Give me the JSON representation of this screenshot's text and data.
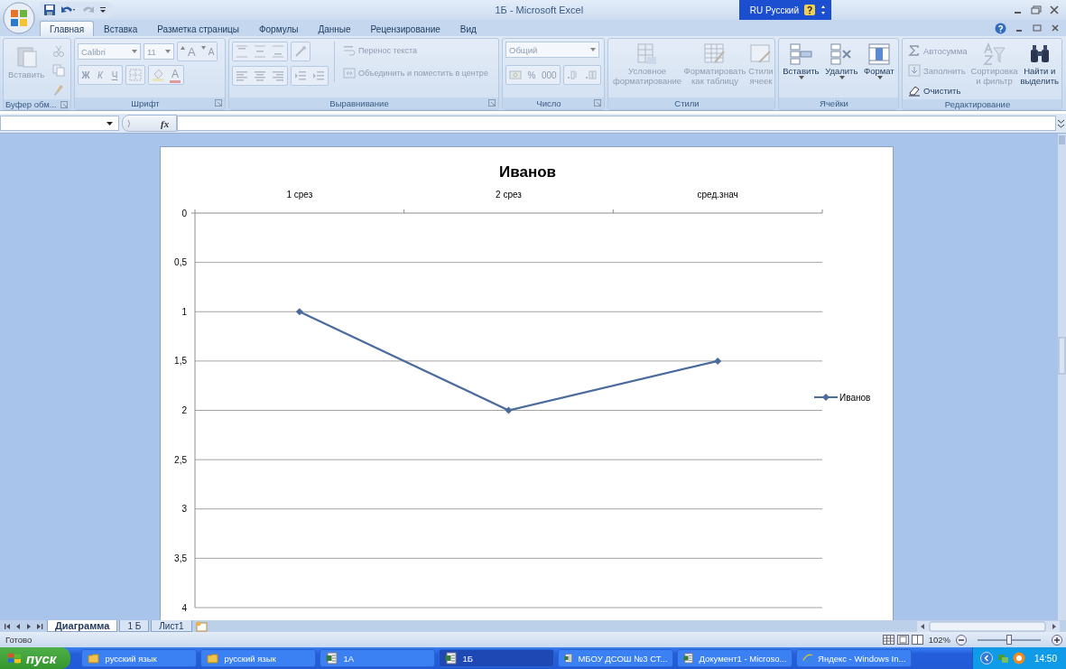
{
  "window": {
    "title": "1Б - Microsoft Excel",
    "language": "RU Русский"
  },
  "ribbon_tabs": [
    {
      "label": "Главная",
      "selected": true
    },
    {
      "label": "Вставка",
      "selected": false
    },
    {
      "label": "Разметка страницы",
      "selected": false
    },
    {
      "label": "Формулы",
      "selected": false
    },
    {
      "label": "Данные",
      "selected": false
    },
    {
      "label": "Рецензирование",
      "selected": false
    },
    {
      "label": "Вид",
      "selected": false
    }
  ],
  "ribbon_groups": [
    {
      "kind": "clipboard",
      "label": "Буфер обм...",
      "disabled": true,
      "paste": "Вставить"
    },
    {
      "kind": "font",
      "label": "Шрифт",
      "disabled": true,
      "font": "Calibri",
      "size": "11",
      "grow": "A",
      "shrink": "A",
      "bold": "Ж",
      "italic": "К",
      "underline": "Ч",
      "font_color": "A"
    },
    {
      "kind": "alignment",
      "label": "Выравнивание",
      "disabled": true,
      "wrap": "Перенос текста",
      "merge": "Объединить и поместить в центре"
    },
    {
      "kind": "number",
      "label": "Число",
      "disabled": true,
      "format": "Общий",
      "percent": "%",
      "thousands": "000"
    },
    {
      "kind": "styles",
      "label": "Стили",
      "commands": [
        {
          "label": "Условное форматирование",
          "disabled": true
        },
        {
          "label": "Форматировать как таблицу",
          "disabled": true
        },
        {
          "label": "Стили ячеек",
          "disabled": true
        }
      ]
    },
    {
      "kind": "cells",
      "label": "Ячейки",
      "commands": [
        {
          "label": "Вставить",
          "disabled": false
        },
        {
          "label": "Удалить",
          "disabled": false
        },
        {
          "label": "Формат",
          "disabled": false
        }
      ]
    },
    {
      "kind": "editing",
      "label": "Редактирование",
      "commands": [
        {
          "label": "Автосумма",
          "disabled": true
        },
        {
          "label": "Заполнить",
          "disabled": true
        },
        {
          "label": "Очистить",
          "disabled": false
        },
        {
          "label": "Сортировка и фильтр",
          "disabled": true
        },
        {
          "label": "Найти и выделить",
          "disabled": false
        }
      ]
    }
  ],
  "formula_bar": {
    "function_label": "fx"
  },
  "chart": {
    "chart_data": {
      "type": "line",
      "title": "Иванов",
      "categories": [
        "1 срез",
        "2 срез",
        "сред.знач"
      ],
      "series": [
        {
          "name": "Иванов",
          "color": "#4a6b9c",
          "marker": "diamond",
          "values": [
            1,
            2,
            1.5
          ]
        }
      ],
      "grid": true,
      "ylim": [
        4,
        0
      ],
      "yticks": [
        {
          "value": 0,
          "label": "0"
        },
        {
          "value": 0.5,
          "label": "0,5"
        },
        {
          "value": 1,
          "label": "1"
        },
        {
          "value": 1.5,
          "label": "1,5"
        },
        {
          "value": 2,
          "label": "2"
        },
        {
          "value": 2.5,
          "label": "2,5"
        },
        {
          "value": 3,
          "label": "3"
        },
        {
          "value": 3.5,
          "label": "3,5"
        },
        {
          "value": 4,
          "label": "4"
        }
      ]
    }
  },
  "sheet_tabs": [
    {
      "label": "Диаграмма",
      "selected": true
    },
    {
      "label": "1 Б",
      "selected": false
    },
    {
      "label": "Лист1",
      "selected": false
    }
  ],
  "status_bar": {
    "status": "Готово",
    "zoom": "102%",
    "zoom_slider": {
      "level": 0.5
    }
  },
  "taskbar": {
    "start": "пуск",
    "buttons": [
      {
        "label": "русский язык",
        "kind": "folder",
        "selected": false
      },
      {
        "label": "русский язык",
        "kind": "folder",
        "selected": false
      },
      {
        "label": "1А",
        "kind": "sheet",
        "selected": false
      },
      {
        "label": "1Б",
        "kind": "sheet",
        "selected": true
      },
      {
        "label": "МБОУ ДСОШ №3 СТ...",
        "kind": "sheet",
        "selected": false
      },
      {
        "label": "Документ1 - Microso...",
        "kind": "sheet",
        "selected": false
      },
      {
        "label": "Яндекс - Windows In...",
        "kind": "browser",
        "selected": false
      }
    ],
    "clock": "14:50"
  }
}
